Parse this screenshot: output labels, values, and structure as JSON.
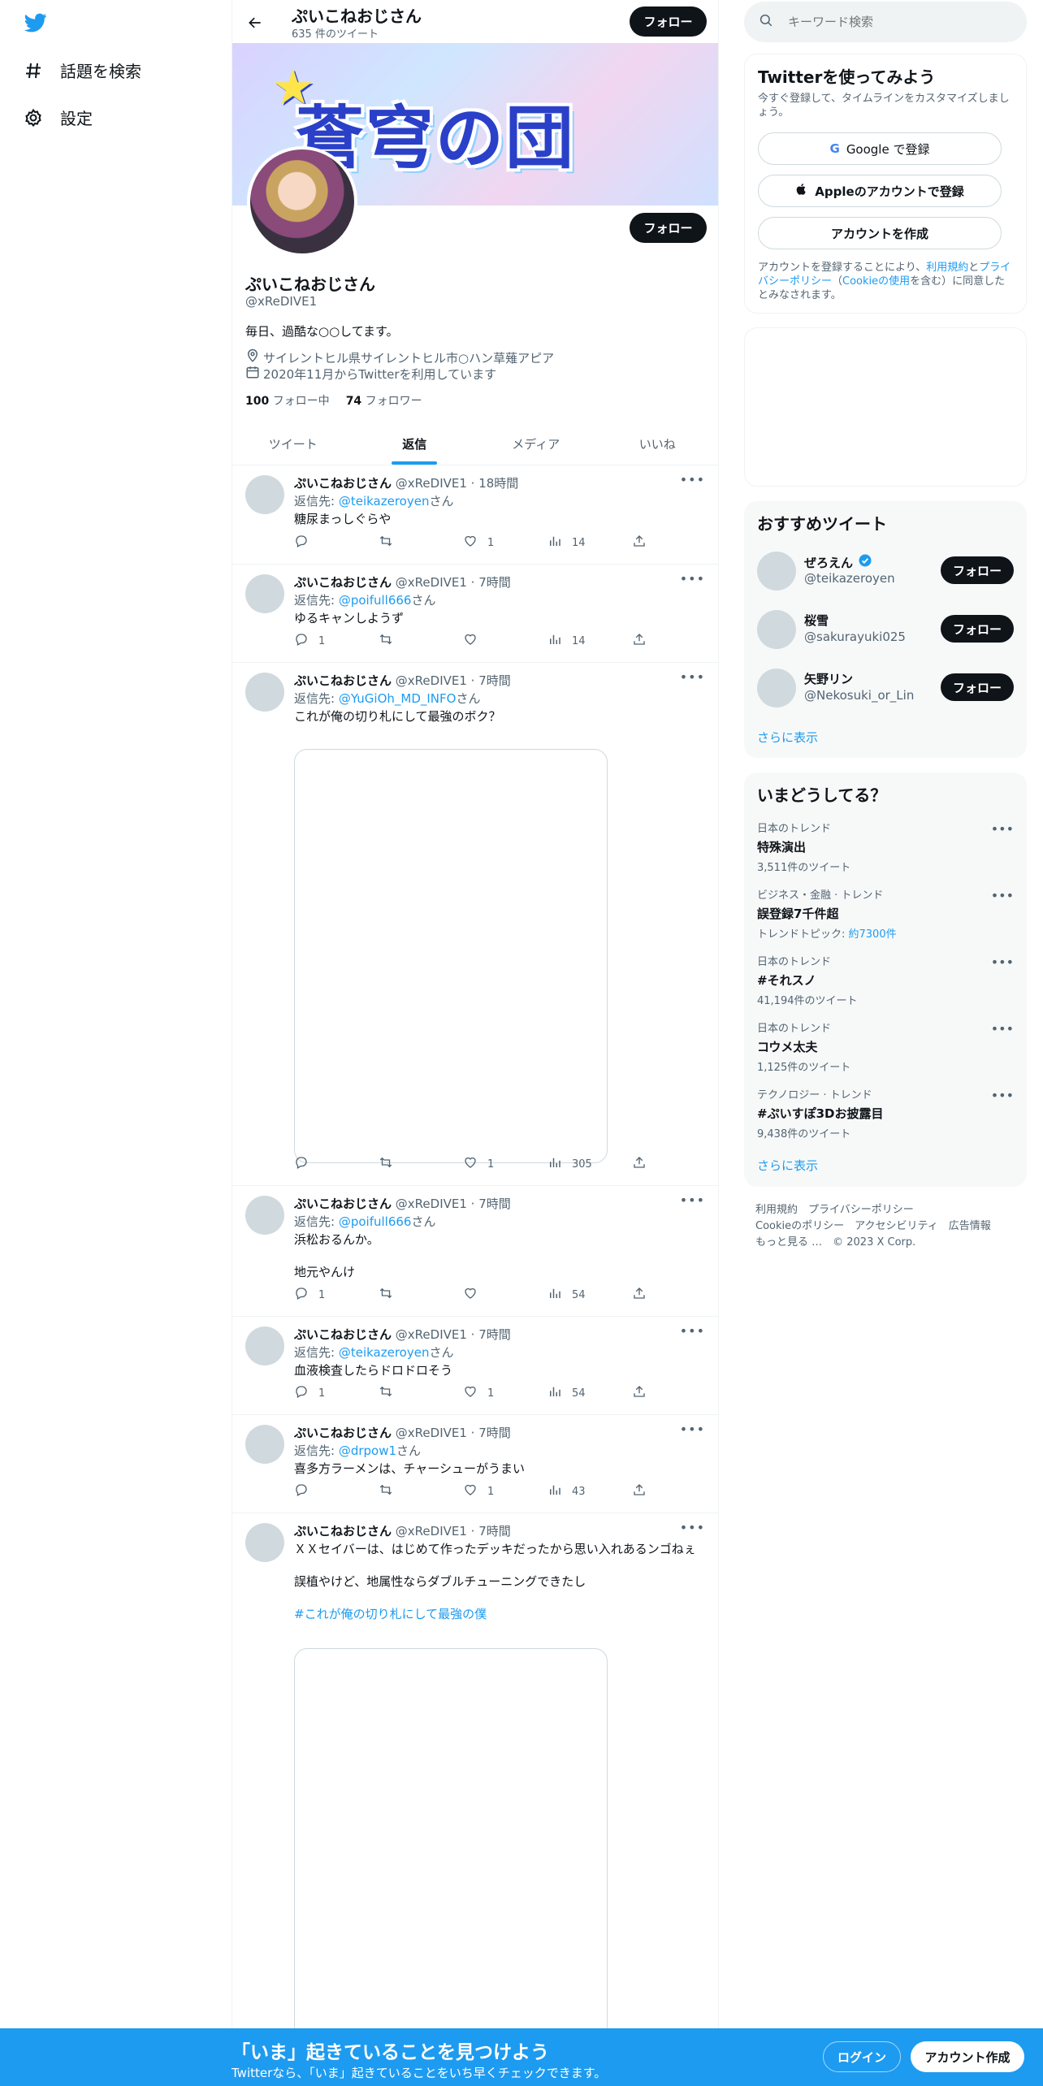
{
  "nav": {
    "logo": "twitter-bird",
    "explore_label": "話題を検索",
    "settings_label": "設定"
  },
  "profile_header": {
    "name": "ぷいこねおじさん",
    "tweet_count": "635 件のツイート",
    "follow_label": "フォロー"
  },
  "banner": {
    "text": "蒼穹の団"
  },
  "profile": {
    "name": "ぷいこねおじさん",
    "handle": "@xReDIVE1",
    "bio": "毎日、過酷な○○してます。",
    "location": "サイレントヒル県サイレントヒル市○ハン草薙アピア",
    "joined": "2020年11月からTwitterを利用しています",
    "following_count": "100",
    "following_label": "フォロー中",
    "followers_count": "74",
    "followers_label": "フォロワー",
    "follow_label": "フォロー"
  },
  "tabs": [
    "ツイート",
    "返信",
    "メディア",
    "いいね"
  ],
  "tweets": [
    {
      "name": "ぷいこねおじさん",
      "meta": "@xReDIVE1 · 18時間",
      "reply_prefix": "返信先: ",
      "reply_to": "@teikazeroyen",
      "reply_suffix": "さん",
      "lines": [
        "糖尿まっしぐらや"
      ],
      "replies": "",
      "retweets": "",
      "likes": "1",
      "views": "14"
    },
    {
      "name": "ぷいこねおじさん",
      "meta": "@xReDIVE1 · 7時間",
      "reply_prefix": "返信先: ",
      "reply_to": "@poifull666",
      "reply_suffix": "さん",
      "lines": [
        "ゆるキャンしようず"
      ],
      "replies": "1",
      "retweets": "",
      "likes": "",
      "views": "14"
    },
    {
      "name": "ぷいこねおじさん",
      "meta": "@xReDIVE1 · 7時間",
      "reply_prefix": "返信先: ",
      "reply_to": "@YuGiOh_MD_INFO",
      "reply_suffix": "さん",
      "lines": [
        "これが俺の切り札にして最強のボク？"
      ],
      "replies": "",
      "retweets": "",
      "likes": "1",
      "views": "305"
    },
    {
      "name": "ぷいこねおじさん",
      "meta": "@xReDIVE1 · 7時間",
      "reply_prefix": "返信先: ",
      "reply_to": "@poifull666",
      "reply_suffix": "さん",
      "lines": [
        "浜松おるんか。",
        "地元やんけ"
      ],
      "replies": "1",
      "retweets": "",
      "likes": "",
      "views": "54"
    },
    {
      "name": "ぷいこねおじさん",
      "meta": "@xReDIVE1 · 7時間",
      "reply_prefix": "返信先: ",
      "reply_to": "@teikazeroyen",
      "reply_suffix": "さん",
      "lines": [
        "血液検査したらドロドロそう"
      ],
      "replies": "1",
      "retweets": "",
      "likes": "1",
      "views": "54"
    },
    {
      "name": "ぷいこねおじさん",
      "meta": "@xReDIVE1 · 7時間",
      "reply_prefix": "返信先: ",
      "reply_to": "@drpow1",
      "reply_suffix": "さん",
      "lines": [
        "喜多方ラーメンは、チャーシューがうまい"
      ],
      "replies": "",
      "retweets": "",
      "likes": "1",
      "views": "43"
    },
    {
      "name": "ぷいこねおじさん",
      "meta": "@xReDIVE1 · 7時間",
      "lines": [
        "ＸＸセイバーは、はじめて作ったデッキだったから思い入れあるンゴねぇ",
        "誤植やけど、地属性ならダブルチューニングできたし"
      ],
      "hashtag": "#これが俺の切り札にして最強の僕"
    }
  ],
  "search": {
    "placeholder": "キーワード検索"
  },
  "signup_card": {
    "title": "Twitterを使ってみよう",
    "subtitle": "今すぐ登録して、タイムラインをカスタマイズしましょう。",
    "google_label": "Google で登録",
    "apple_label": "Appleのアカウントで登録",
    "create_label": "アカウントを作成",
    "terms_prefix": "アカウントを登録することにより、",
    "terms_link": "利用規約",
    "terms_and": "と",
    "privacy_link": "プライバシーポリシー",
    "cookie_open": "（",
    "cookie_link": "Cookieの使用",
    "terms_suffix": "を含む）に同意したとみなされます。"
  },
  "recommended": {
    "title": "おすすめツイート",
    "users": [
      {
        "name": "ぜろえん",
        "handle": "@teikazeroyen",
        "verified": true,
        "follow_label": "フォロー"
      },
      {
        "name": "桜雪",
        "handle": "@sakurayuki025",
        "verified": false,
        "follow_label": "フォロー"
      },
      {
        "name": "矢野リン",
        "handle": "@Nekosuki_or_Lin",
        "verified": false,
        "follow_label": "フォロー"
      }
    ],
    "more": "さらに表示"
  },
  "trends": {
    "title": "いまどうしてる？",
    "items": [
      {
        "category": "日本のトレンド",
        "title": "特殊演出",
        "count": "3,511件のツイート"
      },
      {
        "category": "ビジネス・金融 · トレンド",
        "title": "誤登録7千件超",
        "count_prefix": "トレンドトピック: ",
        "count_link": "約7300件"
      },
      {
        "category": "日本のトレンド",
        "title": "#それスノ",
        "count": "41,194件のツイート"
      },
      {
        "category": "日本のトレンド",
        "title": "コウメ太夫",
        "count": "1,125件のツイート"
      },
      {
        "category": "テクノロジー · トレンド",
        "title": "#ぷいすぽ3Dお披露目",
        "count": "9,438件のツイート"
      }
    ],
    "more": "さらに表示"
  },
  "footer": {
    "row1": "利用規約　プライバシーポリシー",
    "row2": "Cookieのポリシー　アクセシビリティ　広告情報",
    "row3": "もっと見る …　© 2023 X Corp."
  },
  "bottom_bar": {
    "title": "「いま」起きていることを見つけよう",
    "subtitle": "Twitterなら、「いま」起きていることをいち早くチェックできます。",
    "login": "ログイン",
    "signup": "アカウント作成"
  },
  "colors": {
    "accent": "#1d9bf0",
    "text": "#0f1419",
    "muted": "#536471"
  }
}
